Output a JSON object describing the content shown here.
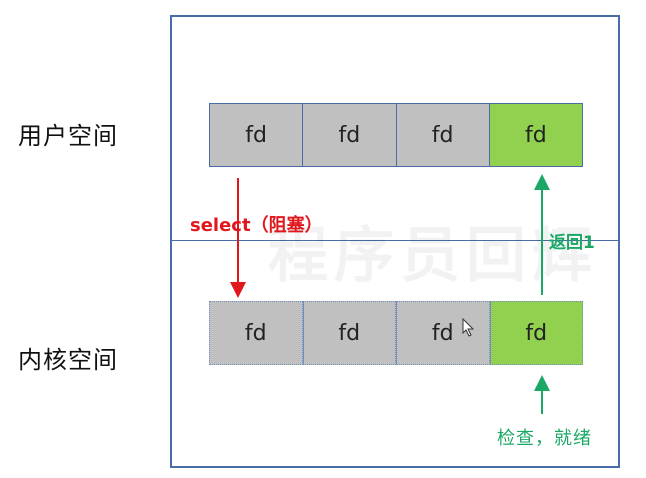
{
  "labels": {
    "user_space": "用户空间",
    "kernel_space": "内核空间",
    "select_call": "select（阻塞）",
    "return_value": "返回1",
    "check_ready": "检查，就绪",
    "watermark": "程序员回辉"
  },
  "user_row": [
    "fd",
    "fd",
    "fd",
    "fd"
  ],
  "kernel_row": [
    "fd",
    "fd",
    "fd",
    "fd"
  ],
  "ready_index": 3,
  "colors": {
    "frame": "#4a6da8",
    "cell": "#c0c0c0",
    "ready": "#92d050",
    "select_arrow": "#e0181e",
    "return_arrow": "#1ba866"
  }
}
